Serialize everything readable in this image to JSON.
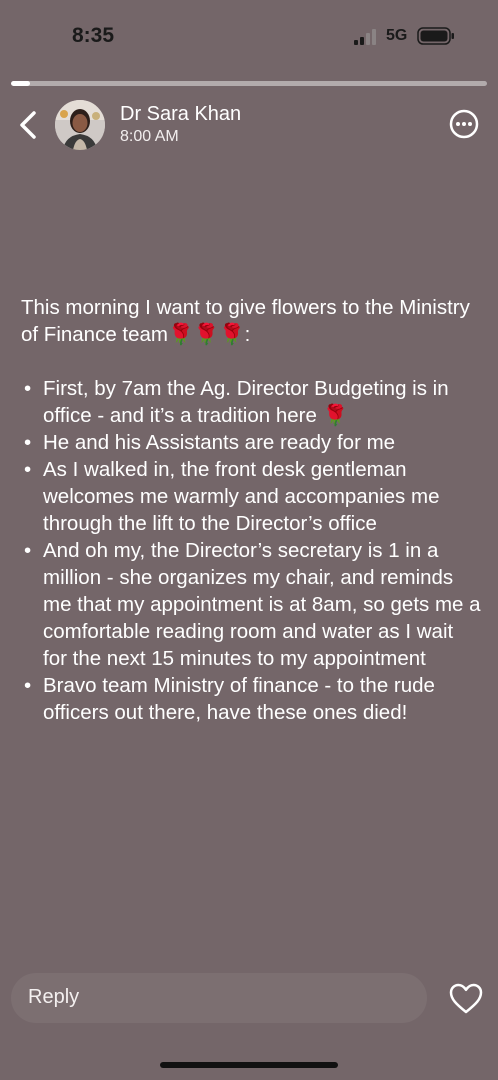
{
  "status_bar": {
    "time": "8:35",
    "network": "5G",
    "signal_icon": "cellular-signal-icon",
    "battery_icon": "battery-icon"
  },
  "story_progress": {
    "fraction": 0.04
  },
  "header": {
    "author_name": "Dr Sara Khan",
    "time": "8:00 AM",
    "back_icon": "chevron-left-icon",
    "more_icon": "more-options-icon"
  },
  "post": {
    "intro": "This morning I want to give flowers to the Ministry of Finance team🌹🌹🌹:",
    "bullets": [
      "First, by 7am the Ag. Director Budgeting is in office - and it’s a tradition here 🌹",
      "He and his Assistants are ready for me",
      "As I walked in, the front desk gentleman welcomes me warmly and accompanies me through the lift to the Director’s office",
      "And oh my, the Director’s secretary is 1 in a million - she organizes my chair, and reminds me that my appointment is at 8am, so gets me a comfortable reading room and water as I wait for the next 15 minutes to my appointment",
      "Bravo team Ministry of finance - to the rude officers out there, have these ones died!"
    ]
  },
  "footer": {
    "reply_placeholder": "Reply",
    "like_icon": "heart-icon"
  },
  "colors": {
    "background": "#746669",
    "text": "#ffffff",
    "status_text": "#1a1a1a"
  }
}
